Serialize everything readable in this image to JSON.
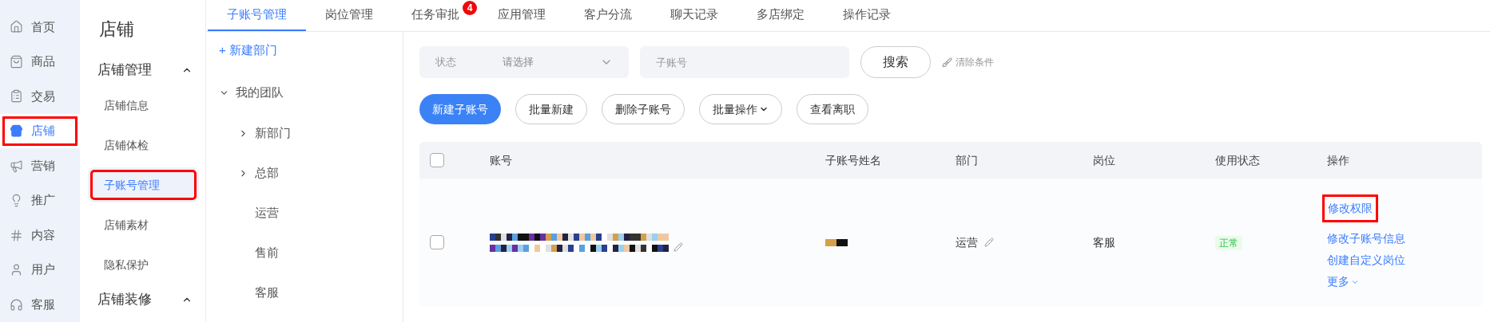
{
  "main_nav": [
    {
      "label": "首页",
      "selected": false
    },
    {
      "label": "商品",
      "selected": false
    },
    {
      "label": "交易",
      "selected": false
    },
    {
      "label": "店铺",
      "selected": true,
      "highlighted": true
    },
    {
      "label": "营销",
      "selected": false
    },
    {
      "label": "推广",
      "selected": false
    },
    {
      "label": "内容",
      "selected": false
    },
    {
      "label": "用户",
      "selected": false
    },
    {
      "label": "客服",
      "selected": false
    }
  ],
  "sub_nav": {
    "title": "店铺",
    "groups": [
      {
        "label": "店铺管理",
        "expanded": true,
        "items": [
          {
            "label": "店铺信息",
            "selected": false
          },
          {
            "label": "店铺体检",
            "selected": false
          },
          {
            "label": "子账号管理",
            "selected": true,
            "highlighted": true
          },
          {
            "label": "店铺素材",
            "selected": false
          },
          {
            "label": "隐私保护",
            "selected": false
          }
        ]
      },
      {
        "label": "店铺装修",
        "expanded": true
      }
    ]
  },
  "tabs": [
    {
      "label": "子账号管理",
      "selected": true
    },
    {
      "label": "岗位管理",
      "selected": false
    },
    {
      "label": "任务审批",
      "selected": false,
      "badge": "4"
    },
    {
      "label": "应用管理",
      "selected": false
    },
    {
      "label": "客户分流",
      "selected": false
    },
    {
      "label": "聊天记录",
      "selected": false
    },
    {
      "label": "多店绑定",
      "selected": false
    },
    {
      "label": "操作记录",
      "selected": false
    }
  ],
  "dept_tree": {
    "new_button": "+ 新建部门",
    "root": {
      "label": "我的团队",
      "expanded": true,
      "children": [
        {
          "label": "新部门",
          "kind": "folder"
        },
        {
          "label": "总部",
          "kind": "folder"
        },
        {
          "label": "运营",
          "kind": "leaf"
        },
        {
          "label": "售前",
          "kind": "leaf"
        },
        {
          "label": "客服",
          "kind": "leaf"
        }
      ]
    }
  },
  "filters": {
    "status": {
      "label": "状态",
      "placeholder": "请选择"
    },
    "account": {
      "placeholder": "子账号"
    },
    "search_button": "搜索",
    "clear_button": "清除条件"
  },
  "actions": [
    {
      "label": "新建子账号",
      "primary": true,
      "dropdown": false
    },
    {
      "label": "批量新建",
      "primary": false,
      "dropdown": false
    },
    {
      "label": "删除子账号",
      "primary": false,
      "dropdown": false
    },
    {
      "label": "批量操作",
      "primary": false,
      "dropdown": true
    },
    {
      "label": "查看离职",
      "primary": false,
      "dropdown": false
    }
  ],
  "table": {
    "all_checked": false,
    "columns": [
      "账号",
      "子账号姓名",
      "部门",
      "岗位",
      "使用状态",
      "操作"
    ],
    "rows": [
      {
        "checked": false,
        "department": "运营",
        "position": "客服",
        "status": "正常",
        "operations": [
          {
            "label": "修改权限",
            "highlighted": true,
            "dropdown": false
          },
          {
            "label": "修改子账号信息",
            "dropdown": false
          },
          {
            "label": "创建自定义岗位",
            "dropdown": false
          },
          {
            "label": "更多",
            "dropdown": true
          }
        ]
      }
    ]
  }
}
